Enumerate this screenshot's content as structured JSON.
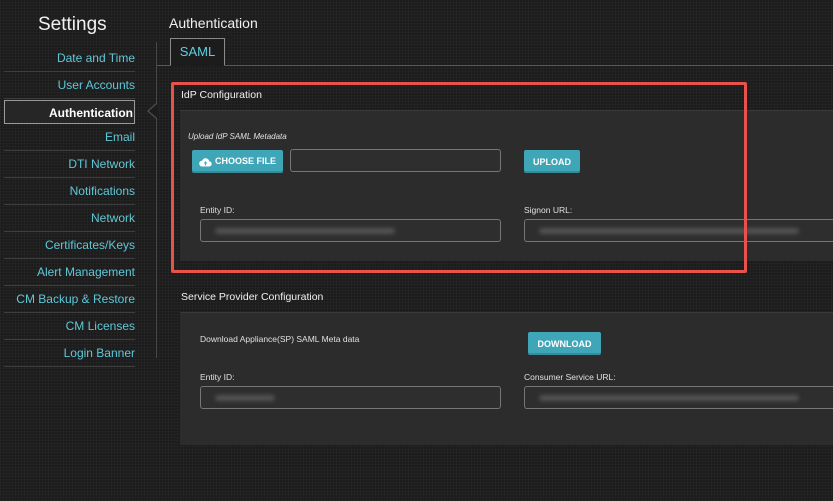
{
  "sidebar": {
    "title": "Settings",
    "items": [
      {
        "label": "Date and Time"
      },
      {
        "label": "User Accounts"
      },
      {
        "label": "Authentication"
      },
      {
        "label": "Email"
      },
      {
        "label": "DTI Network"
      },
      {
        "label": "Notifications"
      },
      {
        "label": "Network"
      },
      {
        "label": "Certificates/Keys"
      },
      {
        "label": "Alert Management"
      },
      {
        "label": "CM Backup & Restore"
      },
      {
        "label": "CM Licenses"
      },
      {
        "label": "Login Banner"
      }
    ],
    "active_index": 2
  },
  "main": {
    "title": "Authentication",
    "tabs": [
      {
        "label": "SAML"
      }
    ],
    "idp": {
      "header": "IdP Configuration",
      "upload_label": "Upload IdP SAML Metadata",
      "choose_file_label": "CHOOSE FILE",
      "upload_button": "UPLOAD",
      "entity_id_label": "Entity ID:",
      "signon_url_label": "Signon URL:"
    },
    "sp": {
      "header": "Service Provider Configuration",
      "download_label": "Download Appliance(SP) SAML Meta data",
      "download_button": "DOWNLOAD",
      "entity_id_label": "Entity ID:",
      "consumer_url_label": "Consumer Service URL:"
    }
  },
  "colors": {
    "accent": "#5fc8d8",
    "button": "#3fa6b8",
    "highlight": "#e8524a",
    "background": "#1c1c1c",
    "panel": "#2c2c2c"
  },
  "icons": {
    "choose_file": "cloud-upload-icon"
  }
}
